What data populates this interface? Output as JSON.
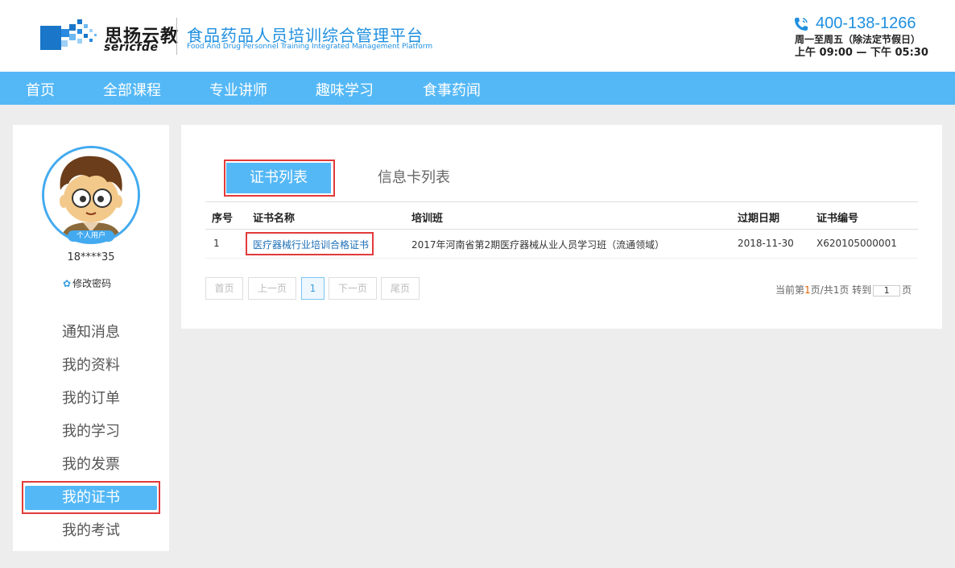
{
  "header": {
    "brand_cn": "思扬云教",
    "brand_en": "sericfde",
    "platform_cn": "食品药品人员培训综合管理平台",
    "platform_en": "Food And Drug Personnel Training Integrated Management Platform",
    "phone": "400-138-1266",
    "hours_days": "周一至周五（除法定节假日）",
    "hours_time": "上午 09:00 — 下午 05:30"
  },
  "nav": {
    "items": [
      "首页",
      "全部课程",
      "专业讲师",
      "趣味学习",
      "食事药闻"
    ]
  },
  "sidebar": {
    "avatar_badge": "个人用户",
    "user_phone": "18****35",
    "change_password": "修改密码",
    "items": [
      "通知消息",
      "我的资料",
      "我的订单",
      "我的学习",
      "我的发票",
      "我的证书",
      "我的考试"
    ],
    "active_index": 5
  },
  "main": {
    "tabs": [
      "证书列表",
      "信息卡列表"
    ],
    "columns": [
      "序号",
      "证书名称",
      "培训班",
      "过期日期",
      "证书编号"
    ],
    "rows": [
      {
        "index": "1",
        "name": "医疗器械行业培训合格证书",
        "class": "2017年河南省第2期医疗器械从业人员学习班（流通领域）",
        "expiry": "2018-11-30",
        "number": "X620105000001"
      }
    ],
    "pagination": {
      "first": "首页",
      "prev": "上一页",
      "current": "1",
      "next": "下一页",
      "last": "尾页",
      "info_prefix": "当前第",
      "current_page": "1",
      "info_mid": "页/共",
      "total_pages": "1",
      "info_suffix": "页 转到",
      "goto_value": "1",
      "goto_suffix": "页"
    }
  },
  "colors": {
    "accent": "#55b8f6",
    "link": "#1e6fb8",
    "highlight": "#e23a3a"
  }
}
